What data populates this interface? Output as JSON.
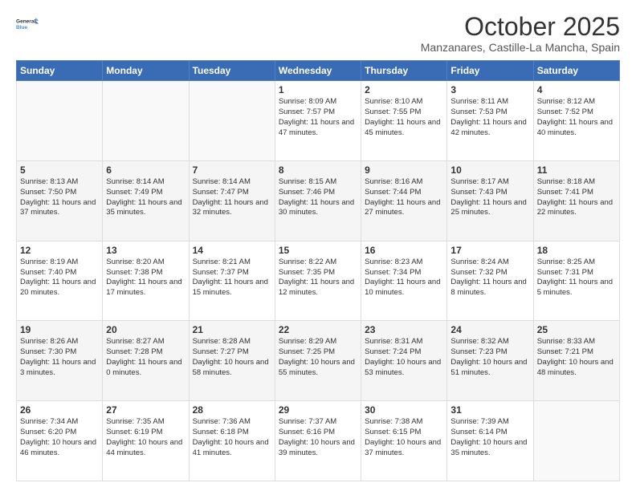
{
  "logo": {
    "line1": "General",
    "line2": "Blue"
  },
  "header": {
    "month": "October 2025",
    "location": "Manzanares, Castille-La Mancha, Spain"
  },
  "days_of_week": [
    "Sunday",
    "Monday",
    "Tuesday",
    "Wednesday",
    "Thursday",
    "Friday",
    "Saturday"
  ],
  "weeks": [
    [
      {
        "day": "",
        "info": ""
      },
      {
        "day": "",
        "info": ""
      },
      {
        "day": "",
        "info": ""
      },
      {
        "day": "1",
        "info": "Sunrise: 8:09 AM\nSunset: 7:57 PM\nDaylight: 11 hours and 47 minutes."
      },
      {
        "day": "2",
        "info": "Sunrise: 8:10 AM\nSunset: 7:55 PM\nDaylight: 11 hours and 45 minutes."
      },
      {
        "day": "3",
        "info": "Sunrise: 8:11 AM\nSunset: 7:53 PM\nDaylight: 11 hours and 42 minutes."
      },
      {
        "day": "4",
        "info": "Sunrise: 8:12 AM\nSunset: 7:52 PM\nDaylight: 11 hours and 40 minutes."
      }
    ],
    [
      {
        "day": "5",
        "info": "Sunrise: 8:13 AM\nSunset: 7:50 PM\nDaylight: 11 hours and 37 minutes."
      },
      {
        "day": "6",
        "info": "Sunrise: 8:14 AM\nSunset: 7:49 PM\nDaylight: 11 hours and 35 minutes."
      },
      {
        "day": "7",
        "info": "Sunrise: 8:14 AM\nSunset: 7:47 PM\nDaylight: 11 hours and 32 minutes."
      },
      {
        "day": "8",
        "info": "Sunrise: 8:15 AM\nSunset: 7:46 PM\nDaylight: 11 hours and 30 minutes."
      },
      {
        "day": "9",
        "info": "Sunrise: 8:16 AM\nSunset: 7:44 PM\nDaylight: 11 hours and 27 minutes."
      },
      {
        "day": "10",
        "info": "Sunrise: 8:17 AM\nSunset: 7:43 PM\nDaylight: 11 hours and 25 minutes."
      },
      {
        "day": "11",
        "info": "Sunrise: 8:18 AM\nSunset: 7:41 PM\nDaylight: 11 hours and 22 minutes."
      }
    ],
    [
      {
        "day": "12",
        "info": "Sunrise: 8:19 AM\nSunset: 7:40 PM\nDaylight: 11 hours and 20 minutes."
      },
      {
        "day": "13",
        "info": "Sunrise: 8:20 AM\nSunset: 7:38 PM\nDaylight: 11 hours and 17 minutes."
      },
      {
        "day": "14",
        "info": "Sunrise: 8:21 AM\nSunset: 7:37 PM\nDaylight: 11 hours and 15 minutes."
      },
      {
        "day": "15",
        "info": "Sunrise: 8:22 AM\nSunset: 7:35 PM\nDaylight: 11 hours and 12 minutes."
      },
      {
        "day": "16",
        "info": "Sunrise: 8:23 AM\nSunset: 7:34 PM\nDaylight: 11 hours and 10 minutes."
      },
      {
        "day": "17",
        "info": "Sunrise: 8:24 AM\nSunset: 7:32 PM\nDaylight: 11 hours and 8 minutes."
      },
      {
        "day": "18",
        "info": "Sunrise: 8:25 AM\nSunset: 7:31 PM\nDaylight: 11 hours and 5 minutes."
      }
    ],
    [
      {
        "day": "19",
        "info": "Sunrise: 8:26 AM\nSunset: 7:30 PM\nDaylight: 11 hours and 3 minutes."
      },
      {
        "day": "20",
        "info": "Sunrise: 8:27 AM\nSunset: 7:28 PM\nDaylight: 11 hours and 0 minutes."
      },
      {
        "day": "21",
        "info": "Sunrise: 8:28 AM\nSunset: 7:27 PM\nDaylight: 10 hours and 58 minutes."
      },
      {
        "day": "22",
        "info": "Sunrise: 8:29 AM\nSunset: 7:25 PM\nDaylight: 10 hours and 55 minutes."
      },
      {
        "day": "23",
        "info": "Sunrise: 8:31 AM\nSunset: 7:24 PM\nDaylight: 10 hours and 53 minutes."
      },
      {
        "day": "24",
        "info": "Sunrise: 8:32 AM\nSunset: 7:23 PM\nDaylight: 10 hours and 51 minutes."
      },
      {
        "day": "25",
        "info": "Sunrise: 8:33 AM\nSunset: 7:21 PM\nDaylight: 10 hours and 48 minutes."
      }
    ],
    [
      {
        "day": "26",
        "info": "Sunrise: 7:34 AM\nSunset: 6:20 PM\nDaylight: 10 hours and 46 minutes."
      },
      {
        "day": "27",
        "info": "Sunrise: 7:35 AM\nSunset: 6:19 PM\nDaylight: 10 hours and 44 minutes."
      },
      {
        "day": "28",
        "info": "Sunrise: 7:36 AM\nSunset: 6:18 PM\nDaylight: 10 hours and 41 minutes."
      },
      {
        "day": "29",
        "info": "Sunrise: 7:37 AM\nSunset: 6:16 PM\nDaylight: 10 hours and 39 minutes."
      },
      {
        "day": "30",
        "info": "Sunrise: 7:38 AM\nSunset: 6:15 PM\nDaylight: 10 hours and 37 minutes."
      },
      {
        "day": "31",
        "info": "Sunrise: 7:39 AM\nSunset: 6:14 PM\nDaylight: 10 hours and 35 minutes."
      },
      {
        "day": "",
        "info": ""
      }
    ]
  ]
}
